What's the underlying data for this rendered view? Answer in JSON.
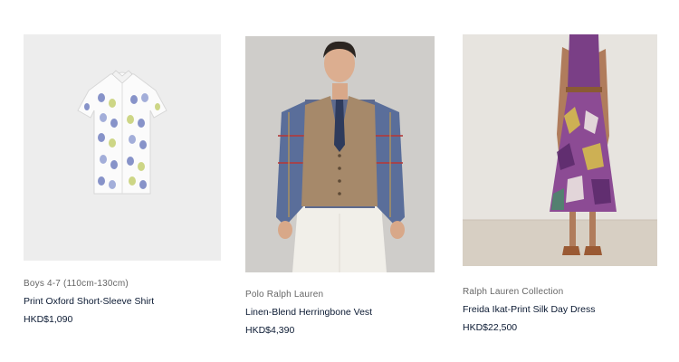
{
  "products": [
    {
      "category": "Boys 4-7 (110cm-130cm)",
      "name": "Print Oxford Short-Sleeve Shirt",
      "price": "HKD$1,090",
      "image_icon": "shirt-image"
    },
    {
      "category": "Polo Ralph Lauren",
      "name": "Linen-Blend Herringbone Vest",
      "price": "HKD$4,390",
      "image_icon": "model-vest-image"
    },
    {
      "category": "Ralph Lauren Collection",
      "name": "Freida Ikat-Print Silk Day Dress",
      "price": "HKD$22,500",
      "image_icon": "model-dress-image"
    }
  ]
}
